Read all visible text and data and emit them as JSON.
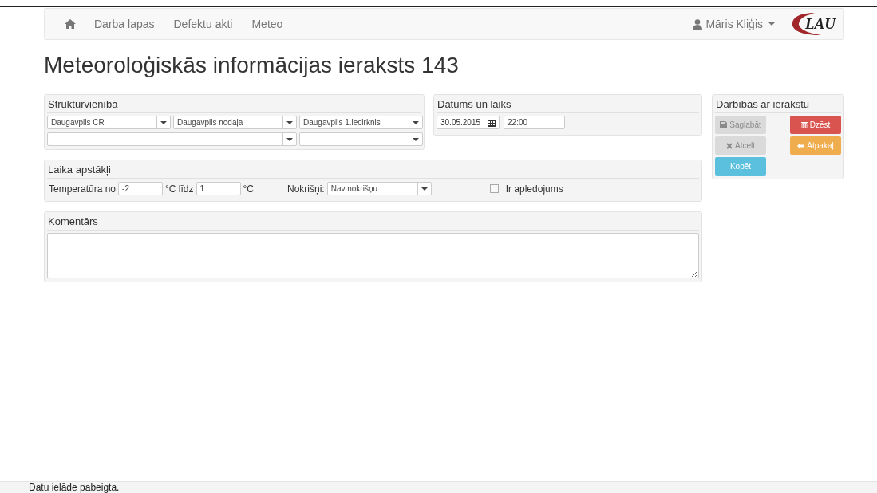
{
  "navbar": {
    "links": [
      {
        "label": "Darba lapas"
      },
      {
        "label": "Defektu akti"
      },
      {
        "label": "Meteo"
      }
    ],
    "user": "Māris Kliģis",
    "logo": "LAU"
  },
  "title": "Meteoroloģiskās informācijas ieraksts 143",
  "structure": {
    "heading": "Struktūrvienība",
    "selects": [
      {
        "value": "Daugavpils CR",
        "wide": false
      },
      {
        "value": "Daugavpils nodaļa",
        "wide": false
      },
      {
        "value": "Daugavpils 1.iecirknis",
        "wide": false
      },
      {
        "wide": true
      },
      {
        "wide": false
      }
    ]
  },
  "datetime": {
    "heading": "Datums un laiks",
    "date": "30.05.2015",
    "time": "22:00"
  },
  "actions": {
    "heading": "Darbības ar ierakstu",
    "buttons": [
      {
        "label": "Saglabāt",
        "kind": "save",
        "disabled": true
      },
      {
        "label": "Dzēst",
        "kind": "delete",
        "disabled": false
      },
      {
        "label": "Atcelt",
        "kind": "cancel",
        "disabled": true
      },
      {
        "label": "Atpakaļ",
        "kind": "back",
        "disabled": false
      },
      {
        "label": "Kopēt",
        "kind": "copy",
        "disabled": false
      }
    ]
  },
  "weather": {
    "heading": "Laika apstākļi",
    "temp_from_label": "Temperatūra no",
    "temp_from": "-2",
    "temp_to_label": "°C līdz",
    "temp_to": "1",
    "unit": "°C",
    "precip_label": "Nokrišņi:",
    "precip": "Nav nokrišņu",
    "icing_label": "Ir apledojums",
    "icing_checked": false
  },
  "comment": {
    "heading": "Komentārs"
  },
  "status_bar": "Datu ielāde pabeigta."
}
